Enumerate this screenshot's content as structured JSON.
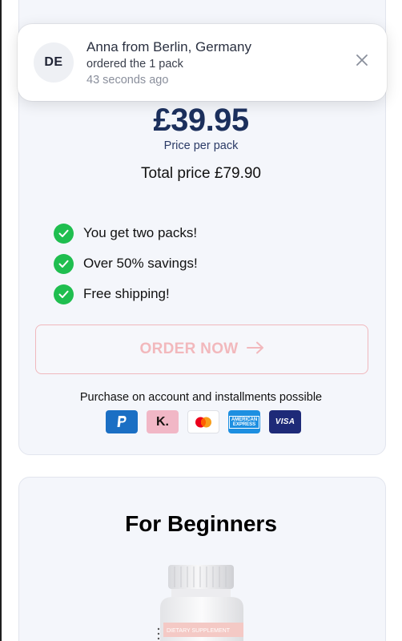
{
  "notification": {
    "badge": "DE",
    "title": "Anna from Berlin, Germany",
    "subtitle": "ordered the 1 pack",
    "time": "43 seconds ago"
  },
  "offer": {
    "price": "£39.95",
    "price_label": "Price per pack",
    "total": "Total price £79.90",
    "features": [
      "You get two packs!",
      "Over 50% savings!",
      "Free shipping!"
    ],
    "order_button": "ORDER NOW",
    "installments": "Purchase on account and installments possible",
    "payment_methods": [
      "paypal",
      "klarna",
      "mastercard",
      "american-express",
      "visa"
    ],
    "payment_text": {
      "klarna": "K.",
      "amex_line1": "AMERICAN",
      "amex_line2": "EXPRESS",
      "visa": "VISA"
    }
  },
  "beginners": {
    "title": "For Beginners",
    "product_label": "DIETARY SUPPLEMENT"
  },
  "colors": {
    "price": "#1b2f5c",
    "check": "#1fbe4f",
    "order_border": "#f0b8bd",
    "card_bg": "#f4f6fb"
  }
}
